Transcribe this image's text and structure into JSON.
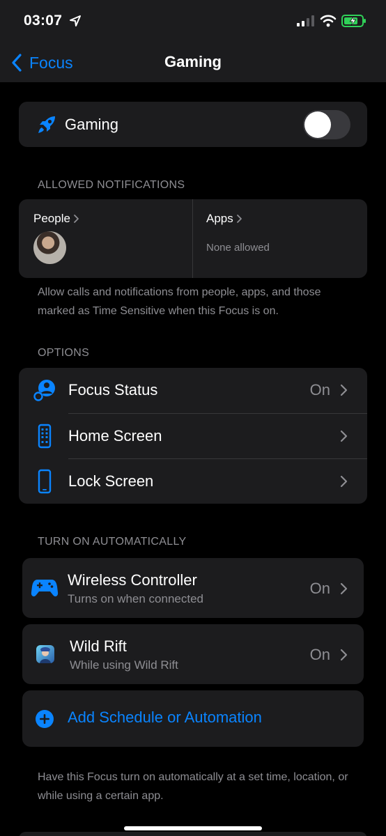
{
  "status_bar": {
    "time": "03:07",
    "icons": [
      "location-arrow-icon",
      "cellular-signal-icon",
      "wifi-icon",
      "battery-charging-icon"
    ]
  },
  "nav": {
    "back_label": "Focus",
    "title": "Gaming"
  },
  "focus_toggle": {
    "label": "Gaming",
    "icon": "rocket-icon",
    "enabled": false
  },
  "allowed_notifications": {
    "header": "ALLOWED NOTIFICATIONS",
    "people_label": "People",
    "apps_label": "Apps",
    "apps_value": "None allowed",
    "footer": "Allow calls and notifications from people, apps, and those marked as Time Sensitive when this Focus is on."
  },
  "options": {
    "header": "OPTIONS",
    "items": [
      {
        "label": "Focus Status",
        "value": "On",
        "icon": "focus-status-icon"
      },
      {
        "label": "Home Screen",
        "value": "",
        "icon": "home-screen-icon"
      },
      {
        "label": "Lock Screen",
        "value": "",
        "icon": "lock-screen-icon"
      }
    ]
  },
  "automation": {
    "header": "TURN ON AUTOMATICALLY",
    "items": [
      {
        "title": "Wireless Controller",
        "subtitle": "Turns on when connected",
        "value": "On",
        "icon": "gamepad-icon"
      },
      {
        "title": "Wild Rift",
        "subtitle": "While using Wild Rift",
        "value": "On",
        "icon": "wild-rift-app-icon"
      }
    ],
    "add_label": "Add Schedule or Automation",
    "footer": "Have this Focus turn on automatically at a set time, location, or while using a certain app."
  },
  "colors": {
    "accent": "#0a84ff",
    "background": "#000000",
    "card": "#1c1c1e",
    "secondary_text": "#8e8e93",
    "battery_green": "#30d158"
  }
}
